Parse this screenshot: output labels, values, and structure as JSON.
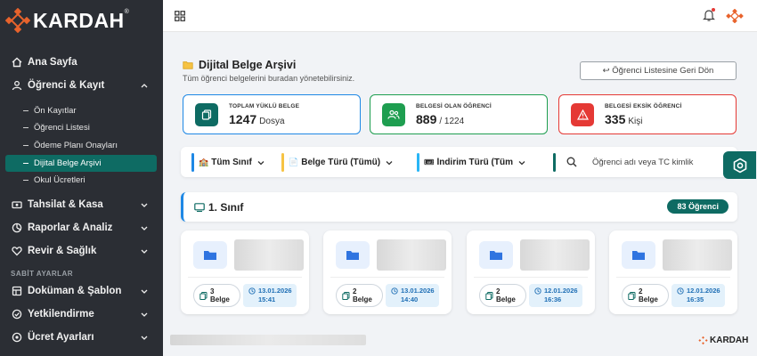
{
  "brand": {
    "name": "KARDAH",
    "reg": "®",
    "accent": "#e8632c",
    "primary": "#0e6b63"
  },
  "sidebar": {
    "items": [
      {
        "label": "Ana Sayfa",
        "icon": "home-icon"
      },
      {
        "label": "Öğrenci & Kayıt",
        "icon": "user-icon"
      },
      {
        "label": "Tahsilat & Kasa",
        "icon": "cash-icon"
      },
      {
        "label": "Raporlar & Analiz",
        "icon": "chart-icon"
      },
      {
        "label": "Revir & Sağlık",
        "icon": "heart-icon"
      },
      {
        "label": "Doküman & Şablon",
        "icon": "document-icon"
      },
      {
        "label": "Yetkilendirme",
        "icon": "shield-icon"
      },
      {
        "label": "Ücret Ayarları",
        "icon": "settings-icon"
      }
    ],
    "sub_items": [
      {
        "label": "Ön Kayıtlar"
      },
      {
        "label": "Öğrenci Listesi"
      },
      {
        "label": "Ödeme Planı Onayları"
      },
      {
        "label": "Dijital Belge Arşivi"
      },
      {
        "label": "Okul Ücretleri"
      }
    ],
    "section_label": "SABİT AYARLAR"
  },
  "page": {
    "title": "Dijital Belge Arşivi",
    "subtitle": "Tüm öğrenci belgelerini buradan yönetebilirsiniz.",
    "back_button": "↩ Öğrenci Listesine Geri Dön"
  },
  "stats": [
    {
      "label": "TOPLAM YÜKLÜ BELGE",
      "value": "1247",
      "unit": "Dosya",
      "color": "#1e88e5"
    },
    {
      "label": "BELGESİ OLAN ÖĞRENCİ",
      "value": "889",
      "unit": "/ 1224",
      "color": "#1e9e50"
    },
    {
      "label": "BELGESİ EKSİK ÖĞRENCİ",
      "value": "335",
      "unit": "Kişi",
      "color": "#e53935"
    }
  ],
  "filters": {
    "class_select": "Tüm Sınıf",
    "doc_type_select": "Belge Türü (Tümü)",
    "discount_select": "İndirim Türü (Tüm",
    "search_placeholder": "Öğrenci adı veya TC kimlik"
  },
  "class_group": {
    "title": "1. Sınıf",
    "badge": "83 Öğrenci"
  },
  "cards": [
    {
      "count": "3",
      "count_label": "Belge",
      "date": "13.01.2026",
      "time": "15:41"
    },
    {
      "count": "2",
      "count_label": "Belge",
      "date": "13.01.2026",
      "time": "14:40"
    },
    {
      "count": "2",
      "count_label": "Belge",
      "date": "12.01.2026",
      "time": "16:36"
    },
    {
      "count": "2",
      "count_label": "Belge",
      "date": "12.01.2026",
      "time": "16:35"
    }
  ],
  "footer": {
    "brand": "KARDAH"
  }
}
